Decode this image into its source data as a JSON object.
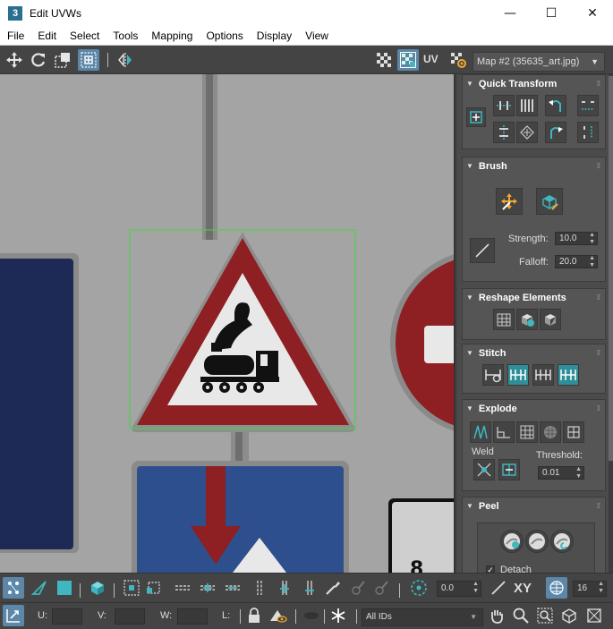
{
  "window": {
    "app_icon": "3",
    "title": "Edit UVWs",
    "min": "—",
    "max": "☐",
    "close": "✕"
  },
  "menu": [
    "File",
    "Edit",
    "Select",
    "Tools",
    "Mapping",
    "Options",
    "Display",
    "View"
  ],
  "toolbar": {
    "uv_label": "UV",
    "map_select": "Map #2 (35635_art.jpg)"
  },
  "panel": {
    "quick_transform": {
      "title": "Quick Transform"
    },
    "brush": {
      "title": "Brush",
      "strength_label": "Strength:",
      "strength": "10.0",
      "falloff_label": "Falloff:",
      "falloff": "20.0"
    },
    "reshape": {
      "title": "Reshape Elements"
    },
    "stitch": {
      "title": "Stitch"
    },
    "explode": {
      "title": "Explode",
      "weld_label": "Weld",
      "threshold_label": "Threshold:",
      "threshold": "0.01"
    },
    "peel": {
      "title": "Peel",
      "detach_label": "Detach",
      "detach_checked": true
    }
  },
  "bottom": {
    "rotate_value": "0.0",
    "xy_label": "XY",
    "grid_value": "16",
    "u_label": "U:",
    "v_label": "V:",
    "w_label": "W:",
    "l_label": "L:",
    "ids_select": "All IDs"
  },
  "colors": {
    "accent": "#5d87a8",
    "teal": "#2f8f98",
    "selection": "#3cd83c"
  }
}
